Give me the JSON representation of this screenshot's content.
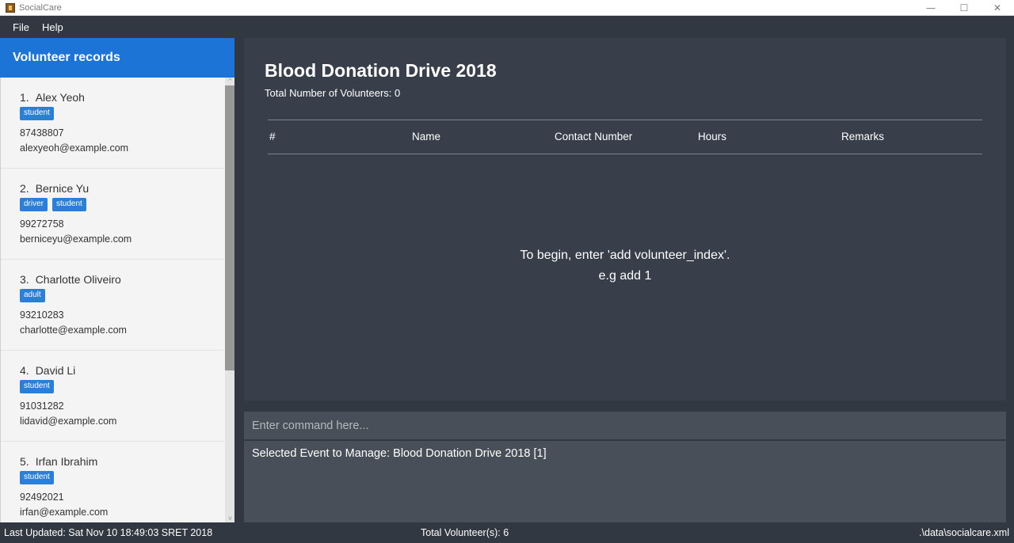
{
  "window": {
    "title": "SocialCare",
    "controls": {
      "minimize": "—",
      "maximize": "☐",
      "close": "✕"
    }
  },
  "menu": {
    "items": [
      "File",
      "Help"
    ]
  },
  "sidebar": {
    "title": "Volunteer records",
    "volunteers": [
      {
        "index": "1.",
        "name": "Alex Yeoh",
        "tags": [
          "student"
        ],
        "phone": "87438807",
        "email": "alexyeoh@example.com"
      },
      {
        "index": "2.",
        "name": "Bernice Yu",
        "tags": [
          "driver",
          "student"
        ],
        "phone": "99272758",
        "email": "berniceyu@example.com"
      },
      {
        "index": "3.",
        "name": "Charlotte Oliveiro",
        "tags": [
          "adult"
        ],
        "phone": "93210283",
        "email": "charlotte@example.com"
      },
      {
        "index": "4.",
        "name": "David Li",
        "tags": [
          "student"
        ],
        "phone": "91031282",
        "email": "lidavid@example.com"
      },
      {
        "index": "5.",
        "name": "Irfan Ibrahim",
        "tags": [
          "student"
        ],
        "phone": "92492021",
        "email": "irfan@example.com"
      }
    ],
    "scroll": {
      "up_glyph": "^",
      "down_glyph": "v"
    }
  },
  "event": {
    "title": "Blood Donation Drive 2018",
    "volunteer_count_label": "Total Number of Volunteers:  0",
    "table_columns": [
      "#",
      "Name",
      "Contact Number",
      "Hours",
      "Remarks"
    ],
    "empty_message_line1": "To begin, enter 'add volunteer_index'.",
    "empty_message_line2": "e.g add 1"
  },
  "command": {
    "placeholder": "Enter command here...",
    "value": ""
  },
  "result": {
    "text": "Selected Event to Manage: Blood Donation Drive 2018 [1]"
  },
  "status": {
    "last_updated": "Last Updated: Sat Nov 10 18:49:03 SRET 2018",
    "total_volunteers": "Total Volunteer(s): 6",
    "file_path": ".\\data\\socialcare.xml"
  },
  "colors": {
    "accent": "#1c75d6",
    "tag": "#2a80d8",
    "dark_bg": "#313841",
    "panel_bg": "#383f4a",
    "input_bg": "#484f58"
  }
}
